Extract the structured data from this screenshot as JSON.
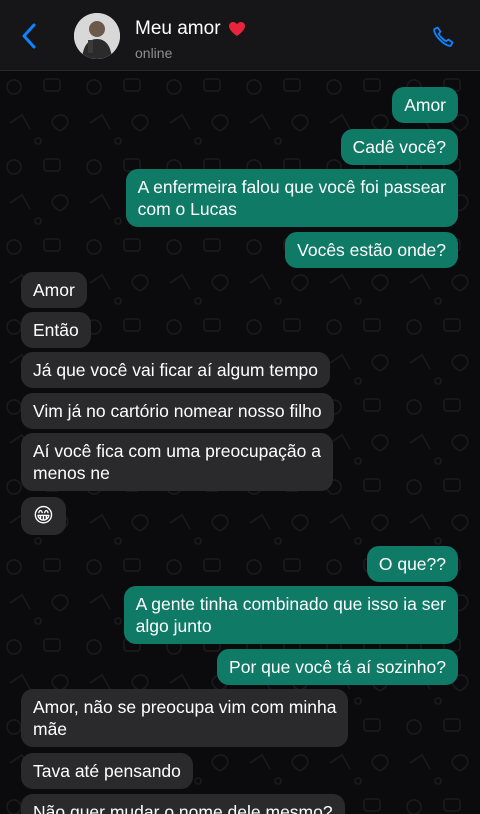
{
  "header": {
    "contact_name": "Meu amor",
    "status": "online",
    "colors": {
      "background": "#161618",
      "icon": "#0a84ff",
      "heart": "#e8243c"
    },
    "icons": {
      "back": "chevron-left-icon",
      "call": "phone-icon",
      "heart": "heart-icon",
      "avatar": "avatar"
    }
  },
  "colors": {
    "outgoing": "#0f7a66",
    "incoming": "#2a2a2c",
    "background": "#0b0b0d"
  },
  "messages": [
    {
      "dir": "out",
      "text": "Amor"
    },
    {
      "dir": "out",
      "text": "Cadê você?"
    },
    {
      "dir": "out",
      "text": "A enfermeira falou que você foi passear\ncom o Lucas"
    },
    {
      "dir": "out",
      "text": "Vocês estão onde?"
    },
    {
      "dir": "in",
      "text": "Amor"
    },
    {
      "dir": "in",
      "text": "Então"
    },
    {
      "dir": "in",
      "text": "Já que você vai ficar aí algum tempo"
    },
    {
      "dir": "in",
      "text": "Vim já no cartório nomear nosso filho"
    },
    {
      "dir": "in",
      "text": "Aí você fica com uma preocupação a\nmenos ne"
    },
    {
      "dir": "in",
      "text": "😁"
    },
    {
      "dir": "out",
      "text": "O que??"
    },
    {
      "dir": "out",
      "text": "A gente tinha combinado que isso ia ser\nalgo junto"
    },
    {
      "dir": "out",
      "text": "Por que você tá aí sozinho?"
    },
    {
      "dir": "in",
      "text": "Amor, não se preocupa vim com minha\nmãe"
    },
    {
      "dir": "in",
      "text": "Tava até pensando"
    },
    {
      "dir": "in",
      "text": "Não quer mudar o nome dele mesmo?"
    }
  ]
}
